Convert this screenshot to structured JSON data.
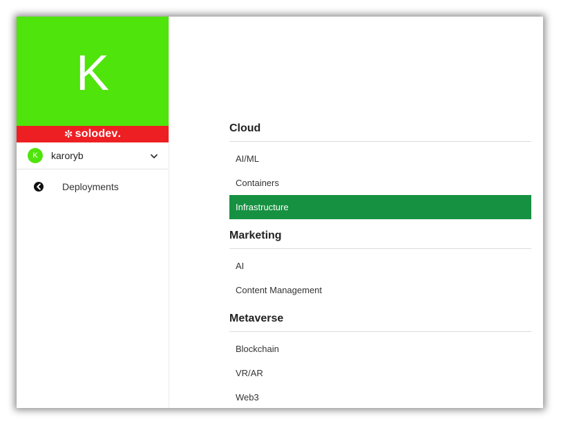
{
  "sidebar": {
    "avatar_letter": "K",
    "brand": {
      "name": "solodev",
      "suffix": ".",
      "mark": "✼"
    },
    "user": {
      "initial": "K",
      "name": "karoryb",
      "menu_icon": "chevron-down-icon"
    },
    "nav": [
      {
        "label": "Deployments",
        "icon": "circle-arrow-left-icon"
      }
    ]
  },
  "content": {
    "groups": [
      {
        "heading": "Cloud",
        "items": [
          {
            "label": "AI/ML",
            "active": false
          },
          {
            "label": "Containers",
            "active": false
          },
          {
            "label": "Infrastructure",
            "active": true
          }
        ]
      },
      {
        "heading": "Marketing",
        "items": [
          {
            "label": "AI",
            "active": false
          },
          {
            "label": "Content Management",
            "active": false
          }
        ]
      },
      {
        "heading": "Metaverse",
        "items": [
          {
            "label": "Blockchain",
            "active": false
          },
          {
            "label": "VR/AR",
            "active": false
          },
          {
            "label": "Web3",
            "active": false
          }
        ]
      }
    ]
  },
  "colors": {
    "avatar_green": "#4fe40b",
    "brand_red": "#ee1f23",
    "active_green": "#169141"
  }
}
